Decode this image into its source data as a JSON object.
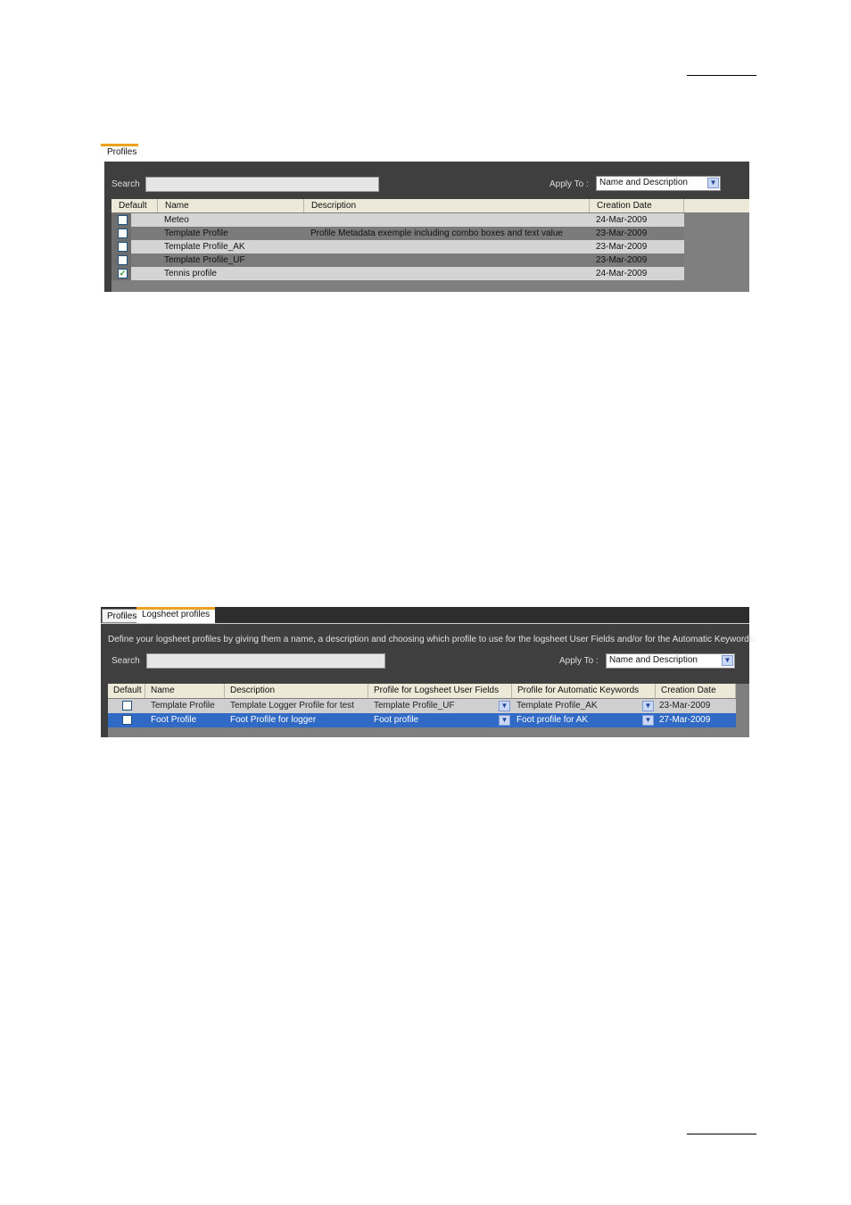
{
  "panel1": {
    "tab_label": "Profiles",
    "search_label": "Search",
    "search_value": "",
    "apply_to_label": "Apply To :",
    "apply_to_value": "Name and Description",
    "columns": [
      "Default",
      "Name",
      "Description",
      "Creation Date"
    ],
    "rows": [
      {
        "default": false,
        "name": "Meteo",
        "description": "",
        "date": "24-Mar-2009"
      },
      {
        "default": false,
        "name": "Template Profile",
        "description": "Profile Metadata exemple including combo boxes and text value",
        "date": "23-Mar-2009"
      },
      {
        "default": false,
        "name": "Template Profile_AK",
        "description": "",
        "date": "23-Mar-2009"
      },
      {
        "default": false,
        "name": "Template Profile_UF",
        "description": "",
        "date": "23-Mar-2009"
      },
      {
        "default": true,
        "name": "Tennis profile",
        "description": "",
        "date": "24-Mar-2009"
      }
    ]
  },
  "panel2": {
    "tabs": [
      "Profiles",
      "Logsheet profiles"
    ],
    "active_tab": "Logsheet profiles",
    "instruction": "Define your logsheet profiles by giving them a name, a description and choosing which profile to use for the logsheet User Fields and/or for the Automatic Keywords.",
    "search_label": "Search",
    "search_value": "",
    "apply_to_label": "Apply To :",
    "apply_to_value": "Name and Description",
    "columns": [
      "Default",
      "Name",
      "Description",
      "Profile for Logsheet User Fields",
      "Profile for Automatic Keywords",
      "Creation Date"
    ],
    "rows": [
      {
        "default": false,
        "name": "Template Profile",
        "description": "Template Logger Profile for test",
        "user_fields": "Template Profile_UF",
        "auto_keywords": "Template Profile_AK",
        "date": "23-Mar-2009"
      },
      {
        "default": false,
        "name": "Foot Profile",
        "description": "Foot Profile for logger",
        "user_fields": "Foot profile",
        "auto_keywords": "Foot profile for AK",
        "date": "27-Mar-2009"
      }
    ]
  },
  "colors": {
    "panel_bg": "#3f3f3f",
    "grid_bg": "#7f7f7f",
    "header_bg": "#ece9d8",
    "tab_accent": "#f0a020",
    "selection": "#316ac5"
  }
}
